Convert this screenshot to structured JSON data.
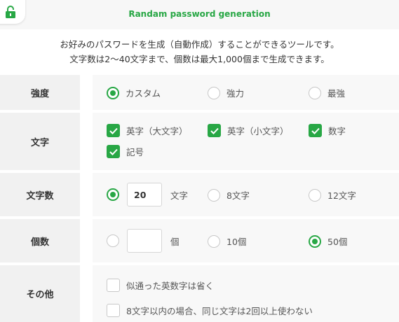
{
  "header": {
    "subtitle": "Randam password generation",
    "logo_icon": "padlock-icon"
  },
  "description": {
    "line1": "お好みのパスワードを生成（自動作成）することができるツールです。",
    "line2": "文字数は2〜40文字まで、個数は最大1,000個まで生成できます。"
  },
  "strength": {
    "label": "強度",
    "options": [
      {
        "label": "カスタム",
        "selected": true
      },
      {
        "label": "強力",
        "selected": false
      },
      {
        "label": "最強",
        "selected": false
      }
    ]
  },
  "characters": {
    "label": "文字",
    "options": [
      {
        "label": "英字（大文字）",
        "checked": true
      },
      {
        "label": "英字（小文字）",
        "checked": true
      },
      {
        "label": "数字",
        "checked": true
      },
      {
        "label": "記号",
        "checked": true
      }
    ]
  },
  "length": {
    "label": "文字数",
    "custom_value": "20",
    "custom_unit": "文字",
    "custom_selected": true,
    "options": [
      {
        "label": "8文字",
        "selected": false
      },
      {
        "label": "12文字",
        "selected": false
      }
    ]
  },
  "count": {
    "label": "個数",
    "custom_value": "",
    "custom_unit": "個",
    "custom_selected": false,
    "options": [
      {
        "label": "10個",
        "selected": false
      },
      {
        "label": "50個",
        "selected": true
      }
    ]
  },
  "other": {
    "label": "その他",
    "options": [
      {
        "label": "似通った英数字は省く",
        "checked": false
      },
      {
        "label": "8文字以内の場合、同じ文字は2回以上使わない",
        "checked": false
      }
    ]
  },
  "colors": {
    "accent": "#28a745",
    "label_bg": "#f1f1f1",
    "content_bg": "#f8f8f8"
  }
}
